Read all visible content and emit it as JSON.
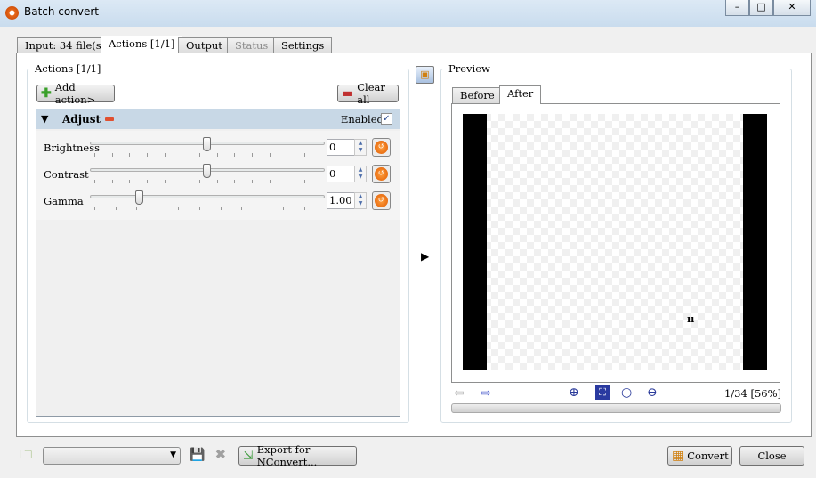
{
  "window": {
    "title": "Batch convert",
    "minimize": "–",
    "maximize": "□",
    "close": "✕"
  },
  "tabs": [
    {
      "label": "Input: 34 file(s)"
    },
    {
      "label": "Actions [1/1]",
      "active": true
    },
    {
      "label": "Output"
    },
    {
      "label": "Status",
      "disabled": true
    },
    {
      "label": "Settings"
    }
  ],
  "actions": {
    "group_label": "Actions [1/1]",
    "add_action": "Add action>",
    "clear_all": "Clear all",
    "adjust": {
      "title": "Adjust",
      "enabled_label": "Enabled",
      "enabled": true,
      "rows": [
        {
          "label": "Brightness",
          "value": "0",
          "level": 0.5
        },
        {
          "label": "Contrast",
          "value": "0",
          "level": 0.5
        },
        {
          "label": "Gamma",
          "value": "1.00",
          "level": 0.2
        }
      ]
    }
  },
  "preview": {
    "group_label": "Preview",
    "tabs": [
      {
        "label": "Before"
      },
      {
        "label": "After",
        "active": true
      }
    ],
    "status": "1/34 [56%]",
    "overlay_text": "ıı"
  },
  "bottom": {
    "preset_select": "",
    "export": "Export for NConvert...",
    "convert": "Convert",
    "close": "Close"
  },
  "colors": {
    "header_bg": "#c8d8e6",
    "accent_orange": "#e86a10",
    "title_gradient": "#c9dcee"
  }
}
